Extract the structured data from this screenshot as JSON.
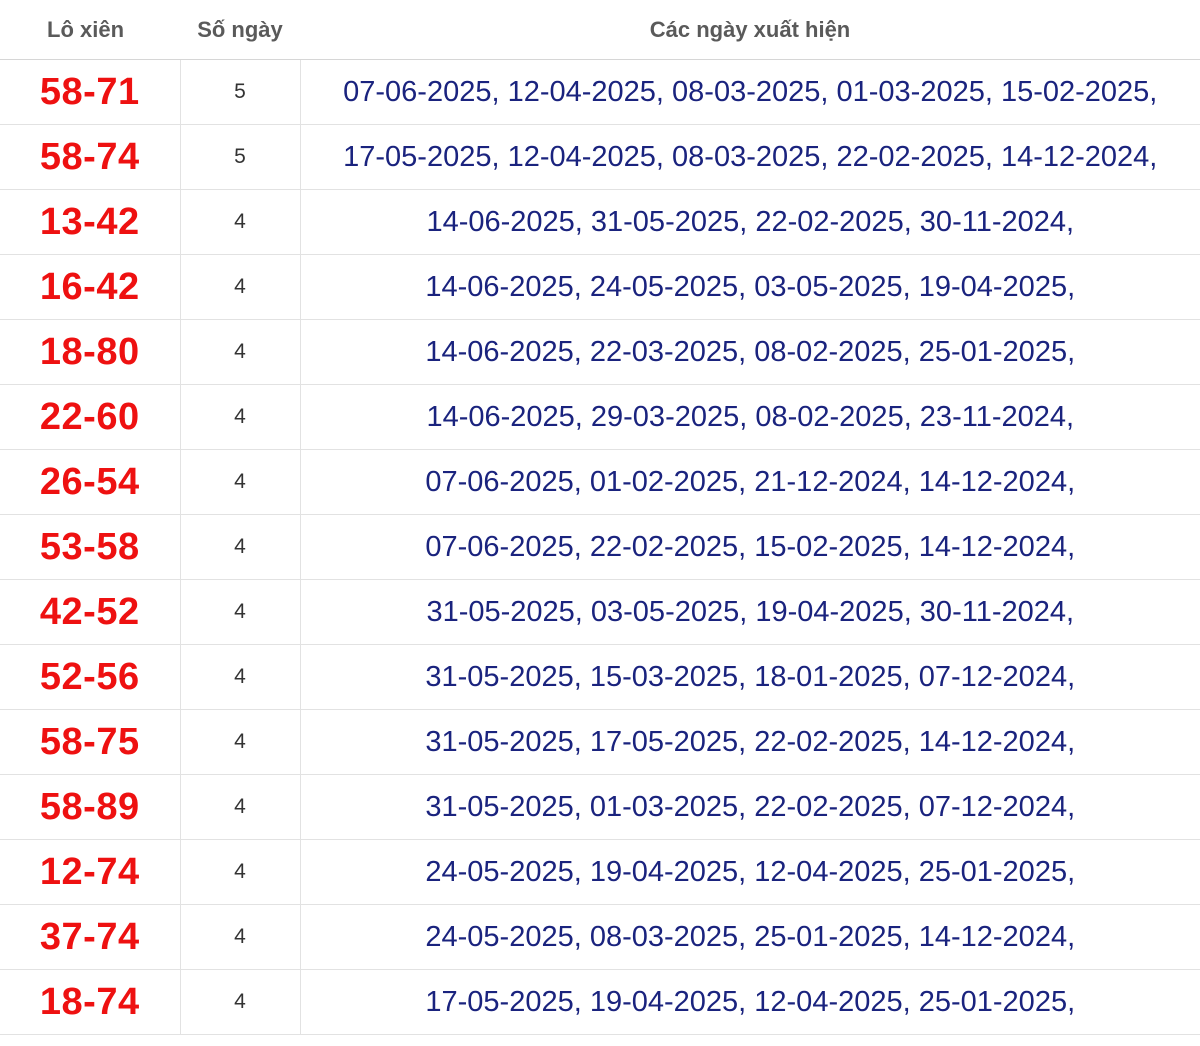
{
  "header": {
    "col_pair": "Lô xiên",
    "col_count": "Số ngày",
    "col_dates": "Các ngày xuất hiện"
  },
  "rows": [
    {
      "pair": "58-71",
      "count": "5",
      "dates": "07-06-2025, 12-04-2025, 08-03-2025, 01-03-2025, 15-02-2025,"
    },
    {
      "pair": "58-74",
      "count": "5",
      "dates": "17-05-2025, 12-04-2025, 08-03-2025, 22-02-2025, 14-12-2024,"
    },
    {
      "pair": "13-42",
      "count": "4",
      "dates": "14-06-2025, 31-05-2025, 22-02-2025, 30-11-2024,"
    },
    {
      "pair": "16-42",
      "count": "4",
      "dates": "14-06-2025, 24-05-2025, 03-05-2025, 19-04-2025,"
    },
    {
      "pair": "18-80",
      "count": "4",
      "dates": "14-06-2025, 22-03-2025, 08-02-2025, 25-01-2025,"
    },
    {
      "pair": "22-60",
      "count": "4",
      "dates": "14-06-2025, 29-03-2025, 08-02-2025, 23-11-2024,"
    },
    {
      "pair": "26-54",
      "count": "4",
      "dates": "07-06-2025, 01-02-2025, 21-12-2024, 14-12-2024,"
    },
    {
      "pair": "53-58",
      "count": "4",
      "dates": "07-06-2025, 22-02-2025, 15-02-2025, 14-12-2024,"
    },
    {
      "pair": "42-52",
      "count": "4",
      "dates": "31-05-2025, 03-05-2025, 19-04-2025, 30-11-2024,"
    },
    {
      "pair": "52-56",
      "count": "4",
      "dates": "31-05-2025, 15-03-2025, 18-01-2025, 07-12-2024,"
    },
    {
      "pair": "58-75",
      "count": "4",
      "dates": "31-05-2025, 17-05-2025, 22-02-2025, 14-12-2024,"
    },
    {
      "pair": "58-89",
      "count": "4",
      "dates": "31-05-2025, 01-03-2025, 22-02-2025, 07-12-2024,"
    },
    {
      "pair": "12-74",
      "count": "4",
      "dates": "24-05-2025, 19-04-2025, 12-04-2025, 25-01-2025,"
    },
    {
      "pair": "37-74",
      "count": "4",
      "dates": "24-05-2025, 08-03-2025, 25-01-2025, 14-12-2024,"
    },
    {
      "pair": "18-74",
      "count": "4",
      "dates": "17-05-2025, 19-04-2025, 12-04-2025, 25-01-2025,"
    }
  ],
  "colors": {
    "pair_text": "#ee1111",
    "dates_text": "#1a237e",
    "header_text": "#5a5a5a"
  }
}
